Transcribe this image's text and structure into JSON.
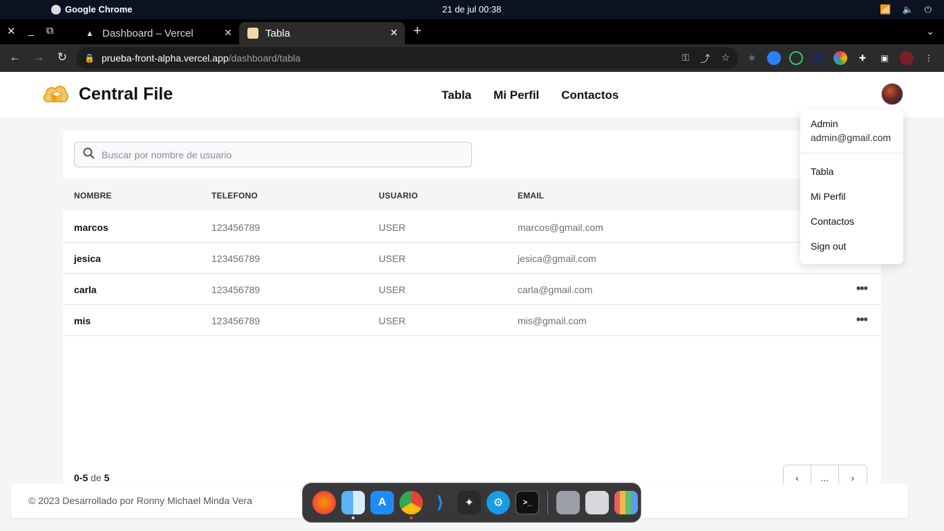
{
  "system": {
    "app_name": "Google Chrome",
    "clock": "21 de jul  00:38"
  },
  "browser": {
    "tabs": [
      {
        "label": "Dashboard – Vercel",
        "active": false
      },
      {
        "label": "Tabla",
        "active": true
      }
    ],
    "url_host": "prueba-front-alpha.vercel.app",
    "url_path": "/dashboard/tabla"
  },
  "site": {
    "brand": "Central File",
    "nav": [
      "Tabla",
      "Mi Perfil",
      "Contactos"
    ]
  },
  "search": {
    "placeholder": "Buscar por nombre de usuario"
  },
  "table": {
    "columns": [
      "NOMBRE",
      "TELEFONO",
      "USUARIO",
      "EMAIL"
    ],
    "rows": [
      {
        "nombre": "marcos",
        "telefono": "123456789",
        "usuario": "USER",
        "email": "marcos@gmail.com"
      },
      {
        "nombre": "jesica",
        "telefono": "123456789",
        "usuario": "USER",
        "email": "jesica@gmail.com"
      },
      {
        "nombre": "carla",
        "telefono": "123456789",
        "usuario": "USER",
        "email": "carla@gmail.com"
      },
      {
        "nombre": "mis",
        "telefono": "123456789",
        "usuario": "USER",
        "email": "mis@gmail.com"
      }
    ],
    "row_menu_glyph": "•••"
  },
  "pagination": {
    "range": "0-5",
    "of": "de",
    "total": "5",
    "prev": "‹",
    "ellipsis": "...",
    "next": "›"
  },
  "user_menu": {
    "name": "Admin",
    "email": "admin@gmail.com",
    "items": [
      "Tabla",
      "Mi Perfil",
      "Contactos",
      "Sign out"
    ]
  },
  "footer": {
    "text": "© 2023 Desarrollado por Ronny Michael Minda Vera"
  },
  "colors": {
    "brand_logo": "#e8a21a",
    "page_bg": "#f4f5f7",
    "header_row_bg": "#f4f5f7"
  },
  "icons": [
    "apple-icon",
    "wifi-icon",
    "volume-icon",
    "power-icon",
    "search-icon",
    "ellipsis-icon",
    "chevron-left-icon",
    "chevron-right-icon",
    "key-icon",
    "share-icon",
    "star-icon",
    "puzzle-icon"
  ]
}
